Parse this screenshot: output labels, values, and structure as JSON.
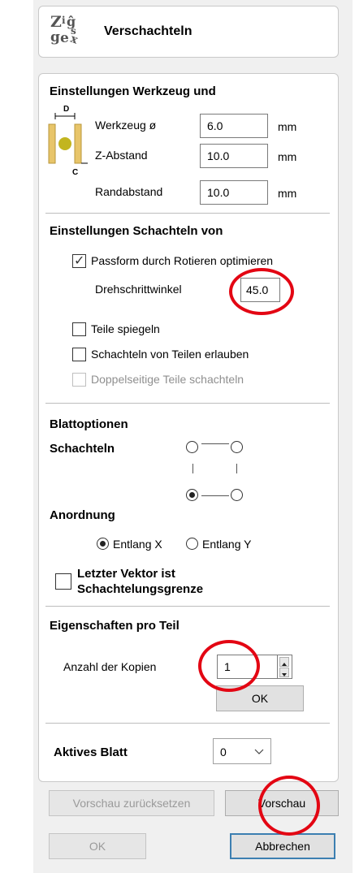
{
  "header": {
    "title": "Verschachteln",
    "logo_text": "Zig ge"
  },
  "tool_settings": {
    "title": "Einstellungen Werkzeug und",
    "diagram_label_d": "D",
    "diagram_label_c": "C",
    "tool_diameter_label": "Werkzeug ø",
    "tool_diameter_value": "6.0",
    "z_clearance_label": "Z-Abstand",
    "z_clearance_value": "10.0",
    "border_gap_label": "Randabstand",
    "border_gap_value": "10.0",
    "unit": "mm"
  },
  "nesting_settings": {
    "title": "Einstellungen Schachteln von",
    "optimize_rotation_label": "Passform durch Rotieren optimieren",
    "optimize_rotation_checked": true,
    "rotation_step_label": "Drehschrittwinkel",
    "rotation_step_value": "45.0",
    "mirror_parts_label": "Teile spiegeln",
    "allow_part_in_part_label": "Schachteln von Teilen erlauben",
    "double_sided_label": "Doppelseitige Teile schachteln"
  },
  "sheet_options": {
    "title": "Blattoptionen",
    "nesting_label": "Schachteln",
    "arrangement_label": "Anordnung",
    "along_x_label": "Entlang X",
    "along_y_label": "Entlang Y",
    "last_vector_label_1": "Letzter Vektor ist",
    "last_vector_label_2": "Schachtelungsgrenze"
  },
  "per_part": {
    "title": "Eigenschaften pro Teil",
    "copies_label": "Anzahl der Kopien",
    "copies_value": "1",
    "ok_label": "OK"
  },
  "active_sheet": {
    "label": "Aktives Blatt",
    "value": "0"
  },
  "footer": {
    "reset_preview_label": "Vorschau zurücksetzen",
    "preview_label": "Vorschau",
    "ok_label": "OK",
    "cancel_label": "Abbrechen"
  },
  "colors": {
    "highlight_circle": "#e30613",
    "tool_body": "#f2d68a",
    "tool_center": "#c2b51f"
  }
}
